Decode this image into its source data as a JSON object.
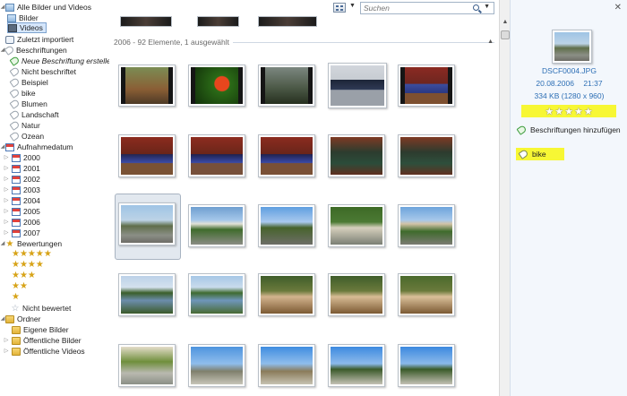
{
  "nav": {
    "all_media": "Alle Bilder und Videos",
    "pictures": "Bilder",
    "videos": "Videos",
    "recently_imported": "Zuletzt importiert",
    "tags_header": "Beschriftungen",
    "create_tag": "Neue Beschriftung erstellen",
    "untagged": "Nicht beschriftet",
    "tags": [
      "Beispiel",
      "bike",
      "Blumen",
      "Landschaft",
      "Natur",
      "Ozean"
    ],
    "date_taken_header": "Aufnahmedatum",
    "years": [
      "2000",
      "2001",
      "2002",
      "2003",
      "2004",
      "2005",
      "2006",
      "2007"
    ],
    "ratings_header": "Bewertungen",
    "rating_rows": [
      "★★★★★",
      "★★★★",
      "★★★",
      "★★",
      "★"
    ],
    "not_rated": "Nicht bewertet",
    "folders_header": "Ordner",
    "folders": [
      "Eigene Bilder",
      "Öffentliche Bilder",
      "Öffentliche Videos"
    ]
  },
  "toolbar": {
    "search_placeholder": "Suchen",
    "view_dropdown": "▼",
    "search_dropdown": "▼"
  },
  "content": {
    "group_header": "2006 - 92 Elemente, 1 ausgewählt",
    "collapse_arrow": "▲"
  },
  "details": {
    "close": "✕",
    "filename": "DSCF0004.JPG",
    "date": "20.08.2006",
    "time": "21:37",
    "size": "334 KB (1280 x 960)",
    "rating_stars": 0,
    "add_tags": "Beschriftungen hinzufügen",
    "tag": "bike"
  },
  "colors": {
    "selection": "#d5e6fb",
    "link_blue": "#2d6fb5",
    "highlight": "#f7f734",
    "star_gold": "#d7a318"
  }
}
